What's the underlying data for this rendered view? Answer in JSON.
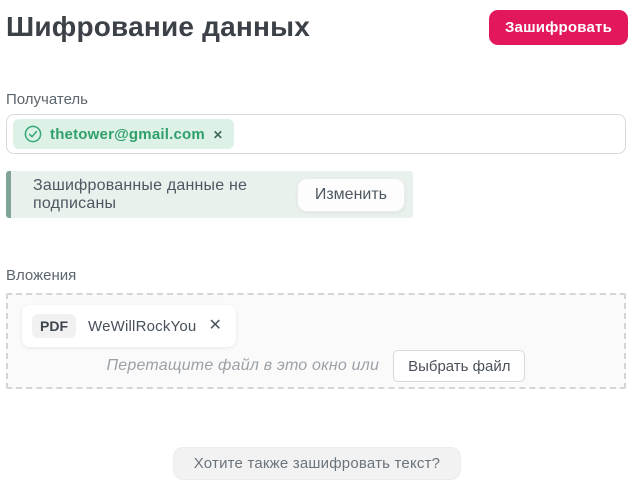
{
  "header": {
    "title": "Шифрование данных",
    "encrypt_button": "Зашифровать"
  },
  "recipient": {
    "label": "Получатель",
    "chip": {
      "email": "thetower@gmail.com"
    }
  },
  "signature_banner": {
    "message": "Зашифрованные данные не подписаны",
    "change_button": "Изменить"
  },
  "attachments": {
    "label": "Вложения",
    "file": {
      "type_badge": "PDF",
      "name": "WeWillRockYou"
    },
    "dropzone_hint": "Перетащите файл в это окно или",
    "choose_file_button": "Выбрать файл"
  },
  "footer": {
    "encrypt_text_button": "Хотите также зашифровать текст?"
  },
  "icons": {
    "verified_icon": "check-circle",
    "chip_remove_glyph": "✕",
    "file_remove_glyph": "✕"
  },
  "colors": {
    "accent": "#e3185c",
    "success_green": "#35a877",
    "chip_bg": "#ddf1e6",
    "banner_bg": "#e9f1ed",
    "banner_stripe": "#7fa497",
    "dropzone_bg": "#fafafa"
  }
}
